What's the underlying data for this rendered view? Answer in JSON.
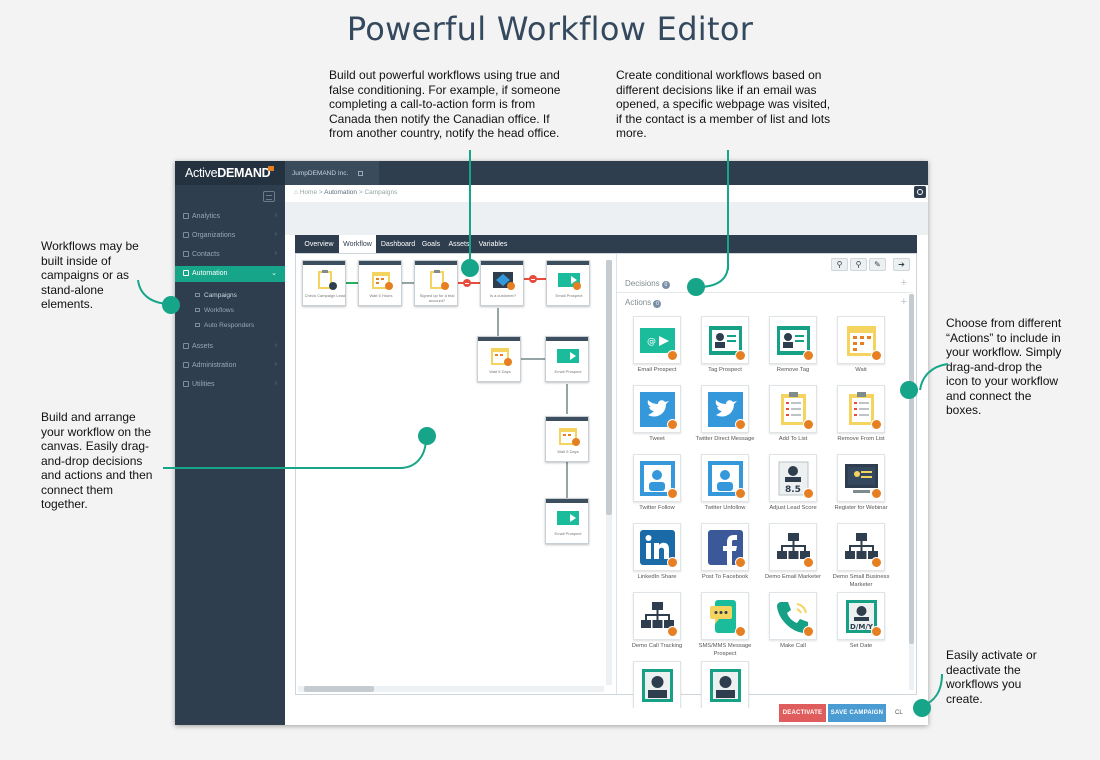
{
  "page": {
    "title": "Powerful Workflow Editor",
    "accent_color": "#17a589"
  },
  "callouts": {
    "conditioning": "Build out powerful workflows using true and false conditioning. For example, if someone completing a call-to-action form is from Canada then notify the Canadian office. If from another country, notify the head office.",
    "conditional": "Create conditional workflows based on different decisions like if an email was opened, a specific webpage was visited, if the contact is a member of list and lots more.",
    "inside_campaigns": "Workflows may be built inside of campaigns or as stand-alone elements.",
    "arrange": "Build and arrange your workflow on the canvas. Easily drag-and-drop decisions and actions and then connect them together.",
    "actions": "Choose from different “Actions” to include in your workflow. Simply drag-and-drop the icon to your workflow and connect the boxes.",
    "activate": "Easily activate or deactivate the workflows you create."
  },
  "app": {
    "logo_light": "Active",
    "logo_bold": "DEMAND",
    "company": "JumpDEMAND Inc.",
    "breadcrumb": {
      "home": "Home",
      "sep": " > ",
      "automation": "Automation",
      "campaigns": "Campaigns"
    },
    "sidebar": {
      "items": [
        {
          "label": "Analytics"
        },
        {
          "label": "Organizations"
        },
        {
          "label": "Contacts"
        },
        {
          "label": "Automation"
        },
        {
          "label": "Assets"
        },
        {
          "label": "Administration"
        },
        {
          "label": "Utilities"
        }
      ],
      "subitems": [
        {
          "label": "Campaigns"
        },
        {
          "label": "Workflows"
        },
        {
          "label": "Auto Responders"
        }
      ]
    },
    "tabs": [
      {
        "label": "Overview"
      },
      {
        "label": "Workflow"
      },
      {
        "label": "Dashboard"
      },
      {
        "label": "Goals"
      },
      {
        "label": "Assets"
      },
      {
        "label": "Variables"
      }
    ],
    "active_tab": "Workflow",
    "canvas_nodes": [
      {
        "label": "Check Campaign Lead"
      },
      {
        "label": "Wait 5 Hours"
      },
      {
        "label": "Signed up for a trial account?"
      },
      {
        "label": "Is a customer?"
      },
      {
        "label": "Email Prospect"
      },
      {
        "label": "Wait 5 Days"
      },
      {
        "label": "Email Prospect"
      },
      {
        "label": "Wait 5 Days"
      },
      {
        "label": "Email Prospect"
      }
    ],
    "panel": {
      "decisions_label": "Decisions",
      "decisions_count": "0",
      "actions_label": "Actions",
      "actions_count": "0",
      "plus": "+",
      "actions": [
        {
          "label": "Email Prospect",
          "icon": "email-icon"
        },
        {
          "label": "Tag Prospect",
          "icon": "tag-prospect-icon"
        },
        {
          "label": "Remove Tag",
          "icon": "remove-tag-icon"
        },
        {
          "label": "Wait",
          "icon": "calendar-icon"
        },
        {
          "label": "Tweet",
          "icon": "twitter-icon"
        },
        {
          "label": "Twitter Direct Message",
          "icon": "twitter-dm-icon"
        },
        {
          "label": "Add To List",
          "icon": "add-list-icon"
        },
        {
          "label": "Remove From List",
          "icon": "remove-list-icon"
        },
        {
          "label": "Twitter Follow",
          "icon": "twitter-follow-icon"
        },
        {
          "label": "Twitter Unfollow",
          "icon": "twitter-unfollow-icon"
        },
        {
          "label": "Adjust Lead Score",
          "icon": "lead-score-icon"
        },
        {
          "label": "Register for Webinar",
          "icon": "webinar-icon"
        },
        {
          "label": "LinkedIn Share",
          "icon": "linkedin-icon"
        },
        {
          "label": "Post To Facebook",
          "icon": "facebook-icon"
        },
        {
          "label": "Demo Email Marketer",
          "icon": "org-chart-icon"
        },
        {
          "label": "Demo Small Business Marketer",
          "icon": "org-chart-icon"
        },
        {
          "label": "Demo Call Tracking",
          "icon": "org-chart-icon"
        },
        {
          "label": "SMS/MMS Message Prospect",
          "icon": "sms-icon"
        },
        {
          "label": "Make Call",
          "icon": "phone-icon"
        },
        {
          "label": "Set Date",
          "icon": "set-date-icon"
        },
        {
          "label": "",
          "icon": "contact-icon"
        },
        {
          "label": "",
          "icon": "contact-icon"
        }
      ],
      "lead_score_value": "8.5",
      "set_date_text": "D/M/Y"
    },
    "buttons": {
      "deactivate": "DEACTIVATE",
      "save": "SAVE CAMPAIGN",
      "close": "CL"
    },
    "colors": {
      "sidebar": "#2e3e4f",
      "deactivate": "#e05d5d",
      "save": "#4b9cd3",
      "badge": "#e67e22"
    }
  }
}
